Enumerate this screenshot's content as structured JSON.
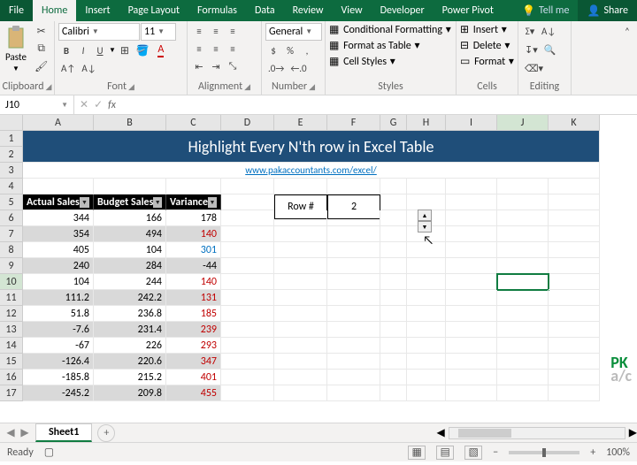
{
  "tabs": {
    "file": "File",
    "home": "Home",
    "insert": "Insert",
    "pagelayout": "Page Layout",
    "formulas": "Formulas",
    "data": "Data",
    "review": "Review",
    "view": "View",
    "developer": "Developer",
    "powerpivot": "Power Pivot",
    "tellme": "Tell me",
    "share": "Share"
  },
  "ribbon": {
    "clipboard": {
      "label": "Clipboard",
      "paste": "Paste"
    },
    "font": {
      "label": "Font",
      "name": "Calibri",
      "size": "11",
      "bold": "B",
      "italic": "I",
      "underline": "U"
    },
    "alignment": {
      "label": "Alignment"
    },
    "number": {
      "label": "Number",
      "format": "General"
    },
    "styles": {
      "label": "Styles",
      "cf": "Conditional Formatting",
      "fat": "Format as Table",
      "cs": "Cell Styles"
    },
    "cells": {
      "label": "Cells",
      "insert": "Insert",
      "delete": "Delete",
      "format": "Format"
    },
    "editing": {
      "label": "Editing"
    }
  },
  "namebox": "J10",
  "formula": "",
  "columns": [
    "A",
    "B",
    "C",
    "D",
    "E",
    "F",
    "G",
    "H",
    "I",
    "J",
    "K"
  ],
  "rows": [
    "1",
    "2",
    "3",
    "4",
    "5",
    "6",
    "7",
    "8",
    "9",
    "10",
    "11",
    "12",
    "13",
    "14",
    "15",
    "16",
    "17"
  ],
  "banner": "Highlight Every N'th row in Excel Table",
  "subtitle": "www.pakaccountants.com/excel/",
  "headers": {
    "a": "Actual Sales",
    "b": "Budget Sales",
    "c": "Variance"
  },
  "spinner": {
    "label": "Row #",
    "value": "2"
  },
  "data_rows": [
    {
      "a": "344",
      "b": "166",
      "c": "178",
      "cls": ""
    },
    {
      "a": "354",
      "b": "494",
      "c": "140",
      "cls": "neg",
      "hl": true
    },
    {
      "a": "405",
      "b": "104",
      "c": "301",
      "cls": "pos"
    },
    {
      "a": "240",
      "b": "284",
      "c": "-44",
      "cls": "",
      "hl": true
    },
    {
      "a": "104",
      "b": "244",
      "c": "140",
      "cls": "neg"
    },
    {
      "a": "111.2",
      "b": "242.2",
      "c": "131",
      "cls": "neg",
      "hl": true
    },
    {
      "a": "51.8",
      "b": "236.8",
      "c": "185",
      "cls": "neg"
    },
    {
      "a": "-7.6",
      "b": "231.4",
      "c": "239",
      "cls": "neg",
      "hl": true
    },
    {
      "a": "-67",
      "b": "226",
      "c": "293",
      "cls": "neg"
    },
    {
      "a": "-126.4",
      "b": "220.6",
      "c": "347",
      "cls": "neg",
      "hl": true
    },
    {
      "a": "-185.8",
      "b": "215.2",
      "c": "401",
      "cls": "neg"
    },
    {
      "a": "-245.2",
      "b": "209.8",
      "c": "455",
      "cls": "neg",
      "hl": true
    }
  ],
  "sheet_tab": "Sheet1",
  "status": {
    "ready": "Ready",
    "zoom": "100%"
  },
  "watermark": {
    "pk": "PK",
    "ac": "a/c"
  }
}
